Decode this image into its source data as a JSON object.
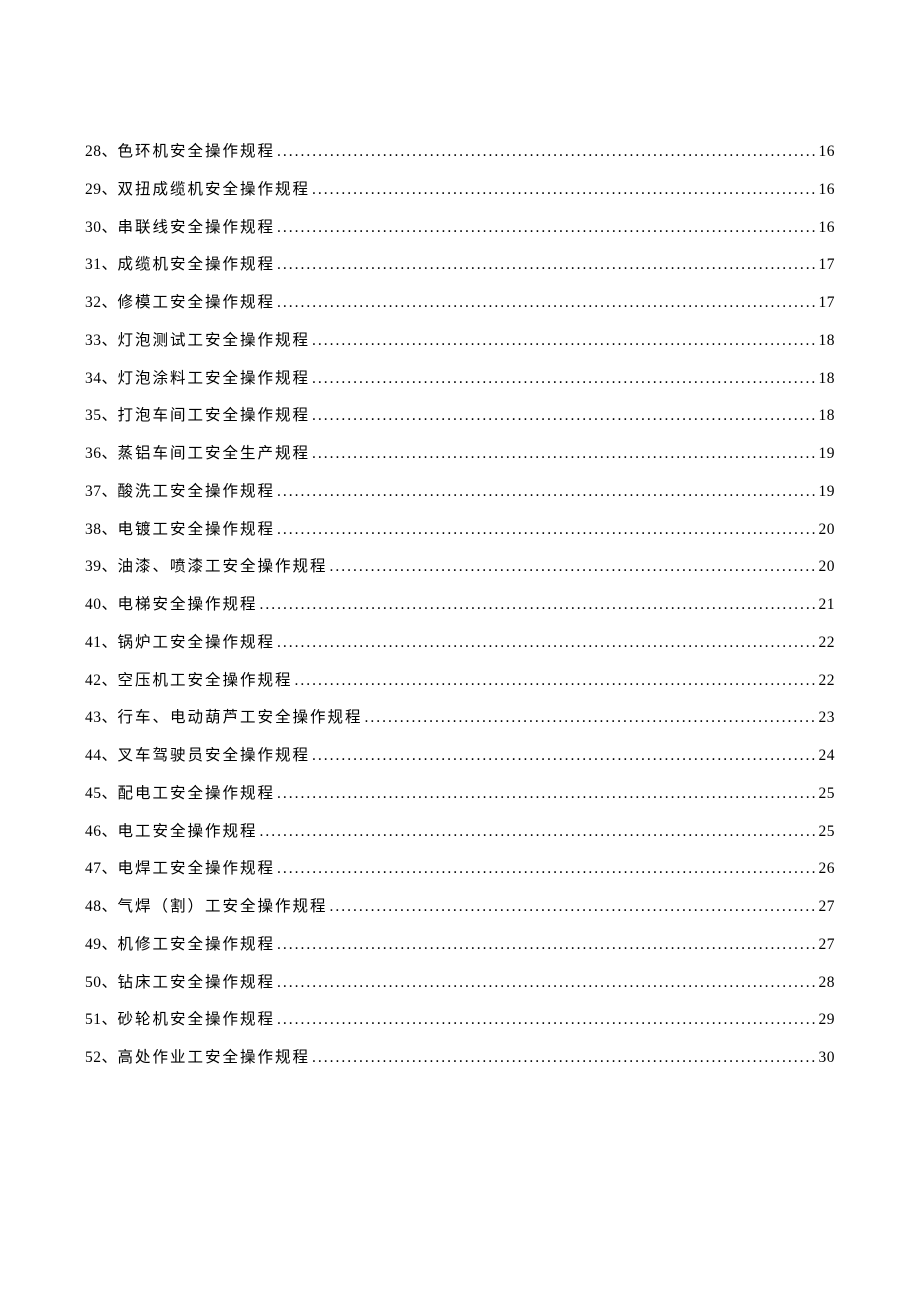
{
  "toc": {
    "entries": [
      {
        "num": "28、",
        "title": "色环机安全操作规程",
        "page": "16"
      },
      {
        "num": "29、",
        "title": "双扭成缆机安全操作规程",
        "page": "16"
      },
      {
        "num": "30、",
        "title": "串联线安全操作规程",
        "page": "16"
      },
      {
        "num": "31、",
        "title": "成缆机安全操作规程",
        "page": "17"
      },
      {
        "num": "32、",
        "title": "修模工安全操作规程",
        "page": "17"
      },
      {
        "num": "33、",
        "title": "灯泡测试工安全操作规程",
        "page": "18"
      },
      {
        "num": "34、",
        "title": "灯泡涂料工安全操作规程",
        "page": "18"
      },
      {
        "num": "35、",
        "title": "打泡车间工安全操作规程",
        "page": "18"
      },
      {
        "num": "36、",
        "title": "蒸铝车间工安全生产规程",
        "page": "19"
      },
      {
        "num": "37、",
        "title": "酸洗工安全操作规程",
        "page": "19"
      },
      {
        "num": "38、",
        "title": "电镀工安全操作规程",
        "page": "20"
      },
      {
        "num": "39、",
        "title": "油漆、喷漆工安全操作规程",
        "page": "20"
      },
      {
        "num": "40、",
        "title": "电梯安全操作规程",
        "page": "21"
      },
      {
        "num": "41、",
        "title": "锅炉工安全操作规程",
        "page": "22"
      },
      {
        "num": "42、",
        "title": "空压机工安全操作规程",
        "page": "22"
      },
      {
        "num": "43、",
        "title": "行车、电动葫芦工安全操作规程",
        "page": "23"
      },
      {
        "num": "44、",
        "title": "叉车驾驶员安全操作规程",
        "page": "24"
      },
      {
        "num": "45、",
        "title": "配电工安全操作规程",
        "page": "25"
      },
      {
        "num": "46、",
        "title": "电工安全操作规程",
        "page": "25"
      },
      {
        "num": "47、",
        "title": "电焊工安全操作规程",
        "page": "26"
      },
      {
        "num": "48、",
        "title": "气焊（割）工安全操作规程",
        "page": "27"
      },
      {
        "num": "49、",
        "title": "机修工安全操作规程",
        "page": "27"
      },
      {
        "num": "50、",
        "title": "钻床工安全操作规程",
        "page": "28"
      },
      {
        "num": "51、",
        "title": "砂轮机安全操作规程",
        "page": "29"
      },
      {
        "num": "52、",
        "title": "高处作业工安全操作规程",
        "page": "30"
      }
    ]
  }
}
